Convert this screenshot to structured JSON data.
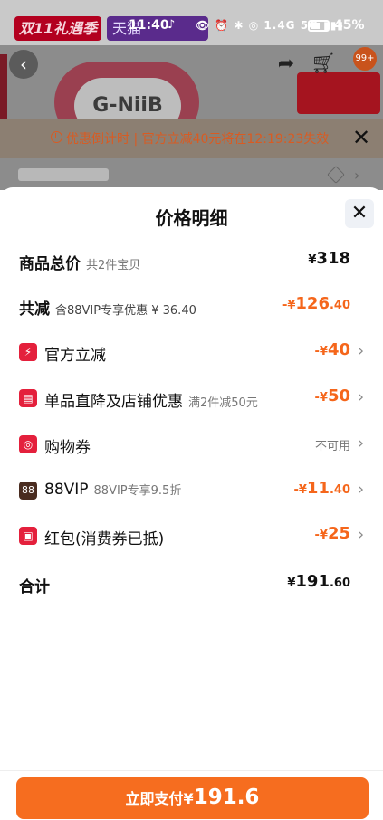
{
  "status_bar": {
    "time": "11:40",
    "network": "1.4G 5G",
    "battery": "45%"
  },
  "background": {
    "promo_tag": "双11礼遇季",
    "promo_tag2": "天猫",
    "product_text": "G-NiiB",
    "cart_badge": "99+",
    "countdown": "优惠倒计时 | 官方立减40元将在12:19:23失效"
  },
  "sheet": {
    "title": "价格明细",
    "rows": [
      {
        "label": "商品总价",
        "sub": "共2件宝贝",
        "yen": "¥",
        "value": "318"
      },
      {
        "label": "共减",
        "sub": "含88VIP专享优惠 ¥ 36.40",
        "value": "-¥126.40",
        "main": "126",
        "dec": ".40"
      },
      {
        "label": "官方立减",
        "icon": "lightning-icon",
        "value": "-¥40",
        "main": "40"
      },
      {
        "label": "单品直降及店铺优惠",
        "icon": "shop-icon",
        "sub": "满2件减50元",
        "value": "-¥50",
        "main": "50"
      },
      {
        "label": "购物券",
        "icon": "coupon-icon",
        "value": "不可用"
      },
      {
        "label": "88VIP",
        "icon": "vip-icon",
        "icon_text": "88",
        "sub": "88VIP专享9.5折",
        "value": "-¥11.40",
        "main": "11",
        "dec": ".40"
      },
      {
        "label": "红包(消费券已抵)",
        "icon": "red-packet-icon",
        "value": "-¥25",
        "main": "25"
      },
      {
        "label": "合计",
        "yen": "¥",
        "main": "191",
        "dec": ".60"
      }
    ],
    "neg_prefix": "-¥",
    "pay_label": "立即支付",
    "pay_yen": "¥",
    "pay_amount": "191.6"
  },
  "colors": {
    "accent": "#f66d1f",
    "discount": "#f5661b",
    "red_icon": "#e4203c",
    "vip_icon": "#4a2c20"
  }
}
